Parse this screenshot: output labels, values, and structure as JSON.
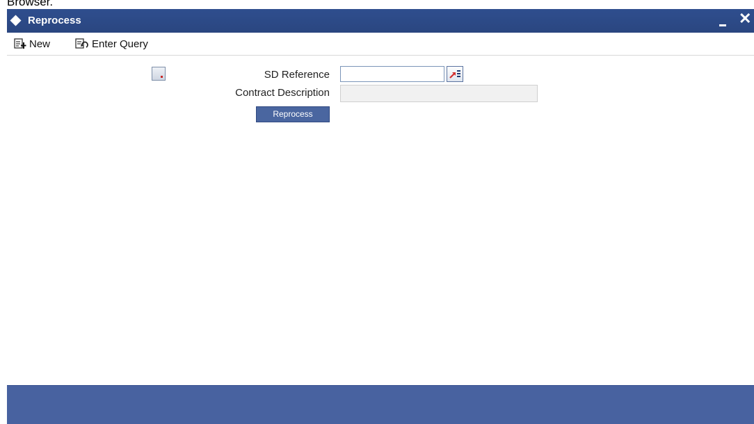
{
  "page": {
    "top_text": "Browser."
  },
  "window": {
    "title": "Reprocess",
    "minimize_label": "minimize",
    "close_label": "✕"
  },
  "toolbar": {
    "new_label": "New",
    "enter_query_label": "Enter Query"
  },
  "form": {
    "sd_reference": {
      "label": "SD Reference",
      "value": ""
    },
    "contract_description": {
      "label": "Contract Description",
      "value": ""
    },
    "reprocess_button": "Reprocess"
  },
  "colors": {
    "titlebar": "#2f4e8e",
    "footer": "#4862a0",
    "button": "#4a66a0"
  },
  "icons": [
    "diamond-icon",
    "new-icon",
    "enter-query-icon",
    "image-thumb-icon",
    "list-of-values-icon",
    "close-icon",
    "minimize-icon"
  ]
}
